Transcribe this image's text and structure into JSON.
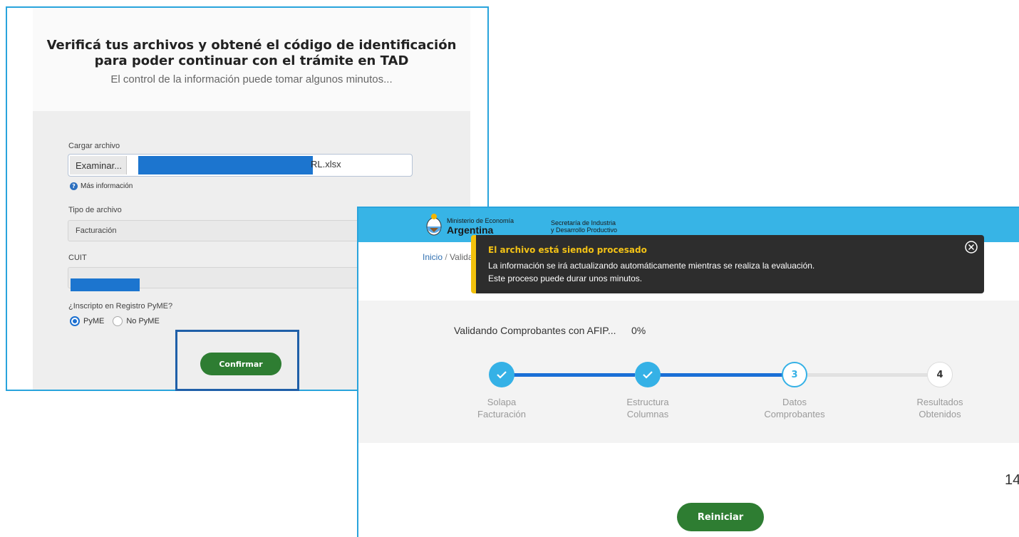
{
  "upload_panel": {
    "title_line1": "Verificá tus archivos y obtené el código de identificación",
    "title_line2": "para poder continuar con el trámite en TAD",
    "subtitle": "El control de la información puede tomar algunos minutos...",
    "file_label": "Cargar archivo",
    "browse_label": "Examinar...",
    "file_name_visible": "RL.xlsx",
    "more_info": "Más información",
    "type_label": "Tipo de archivo",
    "type_value": "Facturación",
    "cuit_label": "CUIT",
    "pyme_question": "¿Inscripto en Registro PyME?",
    "radio_pyme": "PyME",
    "radio_no_pyme": "No PyME",
    "confirm_label": "Confirmar"
  },
  "processing_panel": {
    "header": {
      "ministry_line1": "Ministerio de Economía",
      "ministry_line2": "Argentina",
      "secretaria_line1": "Secretaría de Industria",
      "secretaria_line2": "y Desarrollo Productivo"
    },
    "breadcrumb": {
      "home": "Inicio",
      "separator": "/",
      "current": "Valida"
    },
    "toast": {
      "title": "El archivo está siendo procesado",
      "line1": "La información se irá actualizando automáticamente mientras se realiza la evaluación.",
      "line2": "Este proceso puede durar unos minutos."
    },
    "progress": {
      "text": "Validando Comprobantes con AFIP...",
      "percent": "0%"
    },
    "steps": [
      {
        "number": "1",
        "line1": "Solapa",
        "line2": "Facturación",
        "state": "done"
      },
      {
        "number": "2",
        "line1": "Estructura",
        "line2": "Columnas",
        "state": "done"
      },
      {
        "number": "3",
        "line1": "Datos",
        "line2": "Comprobantes",
        "state": "active"
      },
      {
        "number": "4",
        "line1": "Resultados",
        "line2": "Obtenidos",
        "state": "todo"
      }
    ],
    "restart_label": "Reiniciar"
  },
  "page_number": "14",
  "colors": {
    "panel_border": "#29a4dc",
    "top_bar": "#37b4e6",
    "step_done": "#35b1e6",
    "progress_track": "#1a6fd6",
    "button_green": "#2e7d32",
    "toast_accent": "#f2c10c",
    "redaction": "#1c75cf"
  }
}
